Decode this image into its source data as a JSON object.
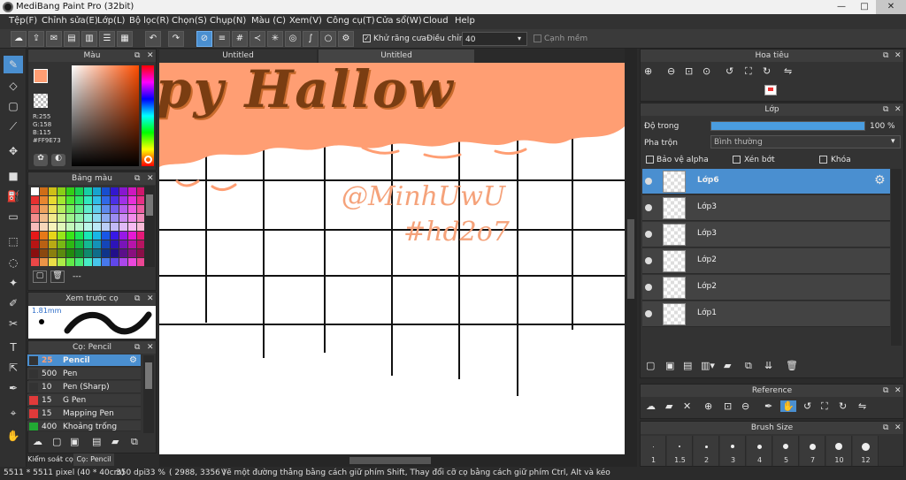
{
  "window": {
    "title": "MediBang Paint Pro (32bit)",
    "minimize": "—",
    "maximize": "□",
    "close": "✕"
  },
  "menu": [
    "Tệp(F)",
    "Chỉnh sửa(E)",
    "Lớp(L)",
    "Bộ lọc(R)",
    "Chọn(S)",
    "Chụp(N)",
    "Màu (C)",
    "Xem(V)",
    "Công cụ(T)",
    "Cửa sổ(W)",
    "Cloud",
    "Help"
  ],
  "toolbar": {
    "antialias_label": "Khử răng cưa",
    "adjust_label": "Điều chỉnh",
    "adjust_value": "40",
    "edge_label": "Cạnh mềm"
  },
  "color_panel": {
    "title": "Màu",
    "r": "R:255",
    "g": "G:158",
    "b": "B:115",
    "hex": "#FF9E73",
    "primary_color": "#FF9E73"
  },
  "palette_panel": {
    "title": "Bảng màu",
    "more": "---"
  },
  "brush_preview": {
    "title": "Xem trước cọ",
    "size": "1.81mm"
  },
  "brush_panel": {
    "title": "Cọ: Pencil",
    "items": [
      {
        "size": "25",
        "name": "Pencil",
        "color": "#333333",
        "selected": true
      },
      {
        "size": "500",
        "name": "Pen",
        "color": "#333333"
      },
      {
        "size": "10",
        "name": "Pen (Sharp)",
        "color": "#333333"
      },
      {
        "size": "15",
        "name": "G Pen",
        "color": "#e03a3a"
      },
      {
        "size": "15",
        "name": "Mapping Pen",
        "color": "#e03a3a"
      },
      {
        "size": "400",
        "name": "Khoảng trống [Edge",
        "color": "#22aa33"
      }
    ]
  },
  "bottom_tabs": {
    "control": "Kiểm soát cọ",
    "brush": "Cọ: Pencil"
  },
  "tabs": [
    "Untitled",
    "Untitled"
  ],
  "canvas_text": {
    "title": "py Hallow",
    "handle": "@MinhUwU",
    "tag": "#hd2o7"
  },
  "navigator": {
    "title": "Hoa tiêu"
  },
  "layer_panel": {
    "title": "Lớp",
    "opacity_label": "Độ trong",
    "opacity_value": "100 %",
    "opacity_fraction": 1.0,
    "blend_label": "Pha trộn",
    "blend_value": "Bình thường",
    "protect_alpha": "Bảo vệ alpha",
    "clip": "Xén bớt",
    "lock": "Khóa",
    "layers": [
      {
        "name": "Lớp6",
        "selected": true
      },
      {
        "name": "Lớp3"
      },
      {
        "name": "Lớp3"
      },
      {
        "name": "Lớp2"
      },
      {
        "name": "Lớp2"
      },
      {
        "name": "Lớp1"
      }
    ]
  },
  "reference": {
    "title": "Reference"
  },
  "brush_size": {
    "title": "Brush Size",
    "sizes": [
      "1",
      "1.5",
      "2",
      "3",
      "4",
      "5",
      "7",
      "10",
      "12"
    ]
  },
  "status": {
    "dims": "5511 * 5511 pixel  (40 * 40cm)",
    "dpi": "350 dpi",
    "zoom": "33 %",
    "coords": "( 2988, 3356 )",
    "hint": "Vẽ một đường thẳng bằng cách giữ phím Shift, Thay đổi cỡ cọ bằng cách giữ phím Ctrl, Alt và kéo"
  }
}
